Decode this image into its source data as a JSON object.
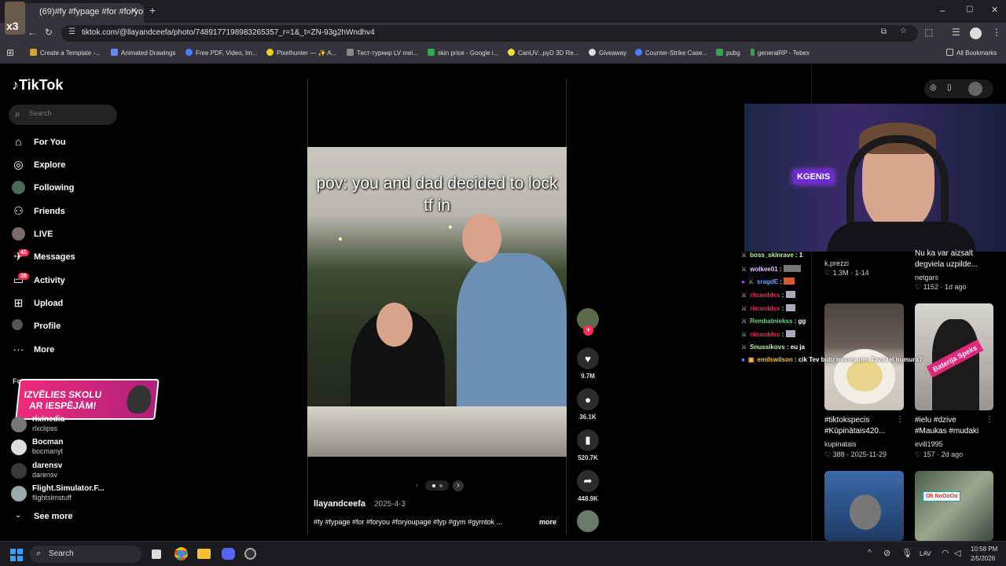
{
  "browser": {
    "tab_count": "(69)",
    "tab_title": "#fy #fypage #for #foryou #...",
    "url": "tiktok.com/@llayandceefa/photo/7489177198983265357_r=1&_t=ZN-93g2hWndhv4",
    "all_bookmarks": "All Bookmarks",
    "bookmarks": [
      "Create a Template -...",
      "Animated Drawings",
      "Free PDF, Video, Im...",
      "Pixelhunter — ✨ A...",
      "Тест-турнир LV mei...",
      "skin price - Google i...",
      "CanUV...pyD 3D Re...",
      "Giveaway",
      "Counter-Strike Case...",
      "pubg",
      "generalRP - Tebex"
    ]
  },
  "sidebar": {
    "logo": "TikTok",
    "search_placeholder": "Search",
    "nav": [
      {
        "label": "For You"
      },
      {
        "label": "Explore"
      },
      {
        "label": "Following"
      },
      {
        "label": "Friends"
      },
      {
        "label": "LIVE"
      },
      {
        "label": "Messages",
        "badge": "41"
      },
      {
        "label": "Activity",
        "badge": "28"
      },
      {
        "label": "Upload"
      },
      {
        "label": "Profile"
      },
      {
        "label": "More"
      }
    ],
    "following_heading": "Fo",
    "ad_banner": {
      "line1": "IZVĒLIES SKOLU",
      "line2": "AR IESPĒJĀM!"
    },
    "accounts": [
      {
        "name": "rixinedia",
        "handle": "rlxclipss"
      },
      {
        "name": "Bocman",
        "handle": "bocmanyt"
      },
      {
        "name": "darensv",
        "handle": "darensv"
      },
      {
        "name": "Flight.Simulator.F...",
        "handle": "flightsimstuff"
      }
    ],
    "see_more": "See more"
  },
  "post": {
    "overlay_text": "pov: you and dad decided to lock tf in",
    "author": "llayandceefa",
    "date": "2025-4-3",
    "caption": "#fy #fypage #for #foryou #foryoupage #fyp #gym #gymtok ...",
    "more": "more",
    "likes": "9.7M",
    "comments": "36.1K",
    "saves": "520.7K",
    "shares": "448.9K"
  },
  "stream": {
    "webcam_sign": "KGENIS",
    "chat": [
      {
        "user": "boss_skinrave",
        "msg": "1",
        "color": "#b8f5a0"
      },
      {
        "user": "wolkee01",
        "msg": "",
        "color": "#e3c3ff"
      },
      {
        "user": "sragdE",
        "msg": "",
        "color": "#6fa0ff"
      },
      {
        "user": "riicarddss",
        "msg": "",
        "color": "#e8305a"
      },
      {
        "user": "riicarddss",
        "msg": "",
        "color": "#e8305a"
      },
      {
        "user": "Rembatniekss",
        "msg": "gg",
        "color": "#5fd88a"
      },
      {
        "user": "riicarddss",
        "msg": "",
        "color": "#e8305a"
      },
      {
        "user": "Snussikovs",
        "msg": "eu ja",
        "color": "#b8f5a0"
      },
      {
        "user": "emilswilson",
        "msg": "cik Tev butu money pec Tava tel numura?",
        "color": "#f0c040"
      }
    ]
  },
  "grid": [
    {
      "caption1": "",
      "caption2": "",
      "author": "k.prezzi",
      "likes": "1.3M",
      "date": "1-14"
    },
    {
      "caption1": "Nu ka var aizsalt",
      "caption2": "degviela uzpilde...",
      "author": "netgars",
      "likes": "1152",
      "date": "1d ago"
    },
    {
      "caption1": "#tiktokspecis",
      "caption2": "#Kūpinātais420...",
      "author": "kupinatais",
      "likes": "388",
      "date": "2025-11-29"
    },
    {
      "caption1": "#ielu #dzive",
      "caption2": "#Maukas #mudaki",
      "author": "evill1995",
      "likes": "157",
      "date": "2d ago",
      "sticker": "Baterija Speks"
    },
    {
      "sticker": "Oh NoOoOo"
    }
  ],
  "taskbar": {
    "search": "Search",
    "lang": "LAV",
    "time": "10:58 PM",
    "date": "2/5/2026"
  }
}
